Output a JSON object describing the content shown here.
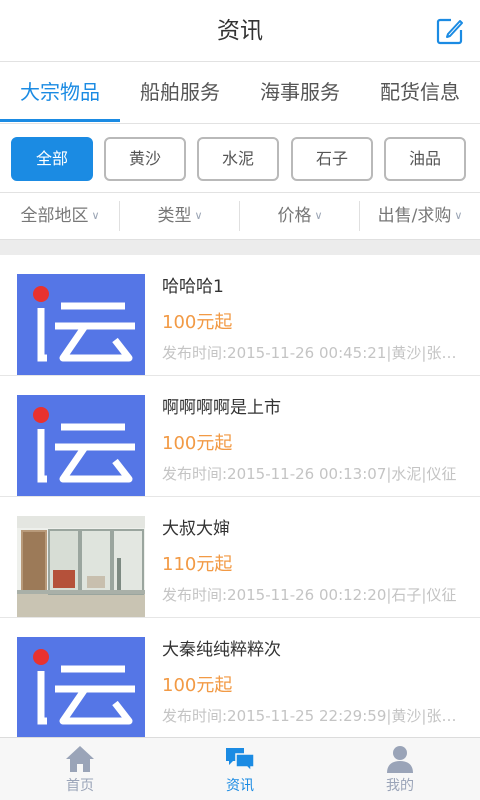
{
  "header": {
    "title": "资讯",
    "edit_icon": "edit-icon"
  },
  "tabs": [
    {
      "label": "大宗物品",
      "active": true
    },
    {
      "label": "船舶服务",
      "active": false
    },
    {
      "label": "海事服务",
      "active": false
    },
    {
      "label": "配货信息",
      "active": false
    }
  ],
  "chips": [
    {
      "label": "全部",
      "active": true
    },
    {
      "label": "黄沙",
      "active": false
    },
    {
      "label": "水泥",
      "active": false
    },
    {
      "label": "石子",
      "active": false
    },
    {
      "label": "油品",
      "active": false
    }
  ],
  "filters": [
    {
      "label": "全部地区"
    },
    {
      "label": "类型"
    },
    {
      "label": "价格"
    },
    {
      "label": "出售/求购"
    }
  ],
  "items": [
    {
      "title": "哈哈哈1",
      "price": "100元起",
      "meta": "发布时间:2015-11-26 00:45:21|黄沙|张…",
      "thumb": "yun-logo"
    },
    {
      "title": "啊啊啊啊是上市",
      "price": "100元起",
      "meta": "发布时间:2015-11-26 00:13:07|水泥|仪征",
      "thumb": "yun-logo"
    },
    {
      "title": "大叔大婶",
      "price": "110元起",
      "meta": "发布时间:2015-11-26 00:12:20|石子|仪征",
      "thumb": "office-photo"
    },
    {
      "title": "大秦纯纯粹粹次",
      "price": "100元起",
      "meta": "发布时间:2015-11-25 22:29:59|黄沙|张…",
      "thumb": "yun-logo"
    }
  ],
  "bottom_nav": [
    {
      "label": "首页",
      "icon": "home-icon",
      "active": false
    },
    {
      "label": "资讯",
      "icon": "chat-icon",
      "active": true
    },
    {
      "label": "我的",
      "icon": "user-icon",
      "active": false
    }
  ],
  "colors": {
    "accent": "#1b8be3",
    "price": "#f29a45",
    "logo_bg": "#5576e6",
    "logo_dot": "#e8322f"
  }
}
